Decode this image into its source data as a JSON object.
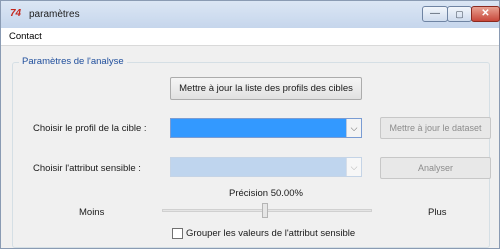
{
  "window": {
    "icon_text": "74",
    "title": "paramètres",
    "controls": {
      "minimize": "—",
      "maximize": "▢",
      "close": "✕"
    }
  },
  "menu": {
    "items": [
      "Contact"
    ]
  },
  "analysis": {
    "group_title": "Paramètres de l'analyse",
    "update_profiles_button": "Mettre à jour la liste des profils des cibles",
    "profile_label": "Choisir le profil de la cible :",
    "profile_value": "",
    "update_dataset_button": "Mettre à jour le dataset",
    "attribute_label": "Choisir l'attribut sensible :",
    "attribute_value": "",
    "analyze_button": "Analyser",
    "precision_label": "Précision 50.00%",
    "precision_value": 0.5,
    "less_label": "Moins",
    "more_label": "Plus",
    "group_values_label": "Grouper les valeurs de l'attribut sensible",
    "group_values_checked": false
  },
  "colors": {
    "selected_combo": "#3399ff",
    "disabled_combo": "#bfd5ee",
    "group_title": "#1f4e9c"
  }
}
